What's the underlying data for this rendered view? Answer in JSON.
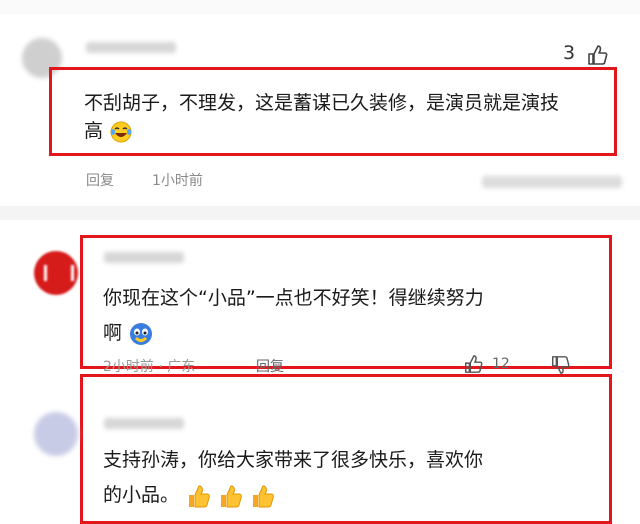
{
  "comments": [
    {
      "text": "不刮胡子，不理发，这是蓄谋已久装修，是演员就是演技",
      "text_cont": "高",
      "like_count": "3",
      "reply_label": "回复",
      "time": "1小时前",
      "emoji_icon": "laughing-tears-icon"
    },
    {
      "text": "你现在这个“小品”一点也不好笑！得继续努力",
      "text_cont": "啊",
      "reply_label": "回复",
      "time": "2小时前",
      "location": "广东",
      "like_count": "12",
      "emoji_icon": "blue-face-icon"
    },
    {
      "text": "支持孙涛，你给大家带来了很多快乐，喜欢你",
      "text_cont": "的小品。",
      "emoji_icon": "thumbs-up-icon"
    }
  ],
  "colors": {
    "highlight": "#e3161c",
    "meta": "#8a8a8a"
  }
}
